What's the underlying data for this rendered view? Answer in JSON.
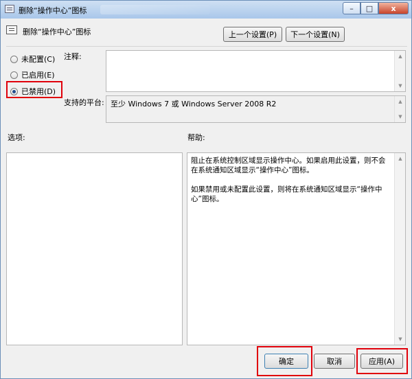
{
  "window": {
    "title": "删除“操作中心”图标",
    "min_label": "–",
    "max_label": "□",
    "close_label": "x"
  },
  "header": {
    "policy_name": "删除“操作中心”图标",
    "prev_setting": "上一个设置(P)",
    "next_setting": "下一个设置(N)"
  },
  "state": {
    "options": [
      {
        "label": "未配置(C)",
        "selected": false
      },
      {
        "label": "已启用(E)",
        "selected": false
      },
      {
        "label": "已禁用(D)",
        "selected": true
      }
    ]
  },
  "comment": {
    "label": "注释:",
    "value": ""
  },
  "platform": {
    "label": "支持的平台:",
    "value": "至少 Windows 7 或 Windows Server 2008 R2"
  },
  "options_section": {
    "label": "选项:"
  },
  "help": {
    "label": "帮助:",
    "paragraphs": [
      "阻止在系统控制区域显示操作中心。如果启用此设置，则不会在系统通知区域显示“操作中心”图标。",
      "如果禁用或未配置此设置，则将在系统通知区域显示“操作中心”图标。"
    ]
  },
  "footer": {
    "ok": "确定",
    "cancel": "取消",
    "apply": "应用(A)"
  },
  "colors": {
    "highlight_box": "#e0000a",
    "selected_radio": "#224c8c"
  }
}
